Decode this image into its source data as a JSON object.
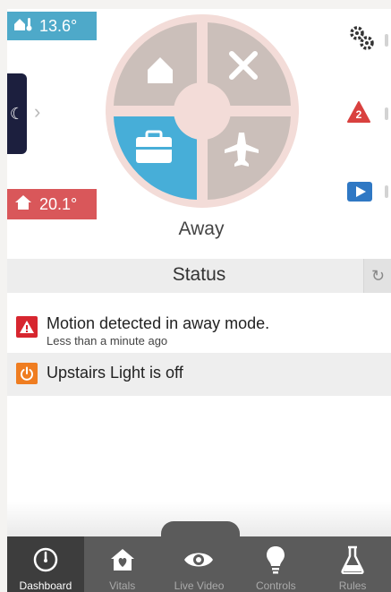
{
  "vitals": {
    "outdoor_temp": "13.6°",
    "indoor_temp": "20.1°"
  },
  "mode": {
    "current": "Away",
    "options": [
      "home",
      "off",
      "away",
      "vacation"
    ]
  },
  "side_icons": {
    "alert_count": "2"
  },
  "status": {
    "title": "Status"
  },
  "notifications": [
    {
      "title": "Motion detected in away mode.",
      "subtitle": "Less than a minute ago",
      "icon": "alert-icon"
    },
    {
      "title": "Upstairs Light is off",
      "subtitle": "",
      "icon": "power-icon"
    }
  ],
  "nav": {
    "items": [
      {
        "label": "Dashboard",
        "icon": "gauge-icon",
        "active": true
      },
      {
        "label": "Vitals",
        "icon": "house-heart-icon"
      },
      {
        "label": "Live Video",
        "icon": "eye-icon"
      },
      {
        "label": "Controls",
        "icon": "lightbulb-icon"
      },
      {
        "label": "Rules",
        "icon": "flask-icon"
      }
    ]
  },
  "colors": {
    "accent_blue": "#4ea9c9",
    "alert_red": "#d9575a",
    "nav_dark": "#5b5b5b",
    "wheel_segment": "#cbbfba",
    "wheel_ring": "#f3dcd8"
  }
}
